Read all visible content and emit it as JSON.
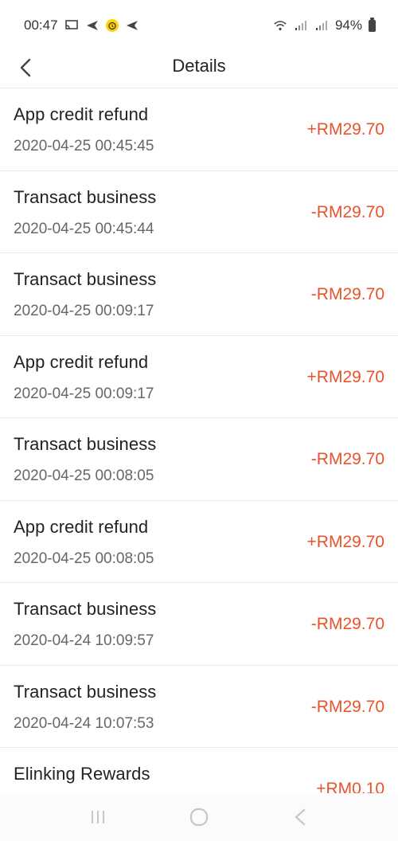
{
  "status_bar": {
    "time": "00:47",
    "battery": "94%",
    "icons": [
      "screen-mirror-icon",
      "send-icon",
      "alarm-icon",
      "send-icon",
      "wifi-icon",
      "signal-icon",
      "signal-icon",
      "battery-icon"
    ]
  },
  "header": {
    "title": "Details",
    "back_icon": "chevron-left-icon"
  },
  "transactions": [
    {
      "name": "App credit refund",
      "time": "2020-04-25 00:45:45",
      "amount": "+RM29.70"
    },
    {
      "name": "Transact business",
      "time": "2020-04-25 00:45:44",
      "amount": "-RM29.70"
    },
    {
      "name": "Transact business",
      "time": "2020-04-25 00:09:17",
      "amount": "-RM29.70"
    },
    {
      "name": "App credit refund",
      "time": "2020-04-25 00:09:17",
      "amount": "+RM29.70"
    },
    {
      "name": "Transact business",
      "time": "2020-04-25 00:08:05",
      "amount": "-RM29.70"
    },
    {
      "name": "App credit refund",
      "time": "2020-04-25 00:08:05",
      "amount": "+RM29.70"
    },
    {
      "name": "Transact business",
      "time": "2020-04-24 10:09:57",
      "amount": "-RM29.70"
    },
    {
      "name": "Transact business",
      "time": "2020-04-24 10:07:53",
      "amount": "-RM29.70"
    },
    {
      "name": "Elinking Rewards",
      "time": "",
      "amount": "+RM0.10"
    }
  ],
  "colors": {
    "amount": "#e8532b",
    "divider": "#e9e9e9"
  },
  "nav_bar": {
    "icons": [
      "recent-apps-icon",
      "home-icon",
      "back-icon"
    ]
  }
}
